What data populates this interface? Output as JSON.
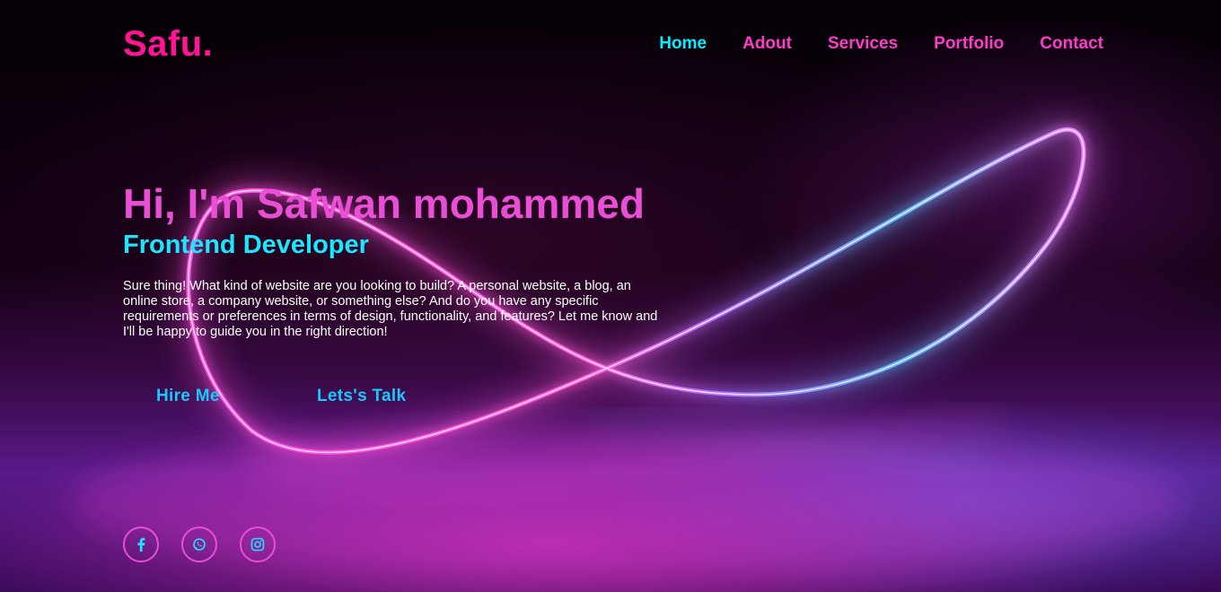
{
  "header": {
    "logo": "Safu.",
    "nav": [
      {
        "label": "Home",
        "active": true
      },
      {
        "label": "Adout",
        "active": false
      },
      {
        "label": "Services",
        "active": false
      },
      {
        "label": "Portfolio",
        "active": false
      },
      {
        "label": "Contact",
        "active": false
      }
    ]
  },
  "hero": {
    "title": "Hi, I'm Safwan mohammed",
    "subtitle": "Frontend Developer",
    "description": "Sure thing! What kind of website are you looking to build? A personal website, a blog, an online store, a company website, or something else? And do you have any specific requirements or preferences in terms of design, functionality, and features? Let me know and I'll be happy to guide you in the right direction!",
    "buttons": {
      "hire": "Hire Me",
      "talk": "Lets's Talk"
    }
  },
  "social": [
    {
      "icon": "facebook-icon"
    },
    {
      "icon": "whatsapp-icon"
    },
    {
      "icon": "instagram-icon"
    }
  ],
  "colors": {
    "brand_pink": "#ff1493",
    "nav_pink": "#ff3cc8",
    "accent_cyan": "#00f0ff",
    "button_blue": "#18c8ff",
    "title_pink": "#e84fd4"
  }
}
